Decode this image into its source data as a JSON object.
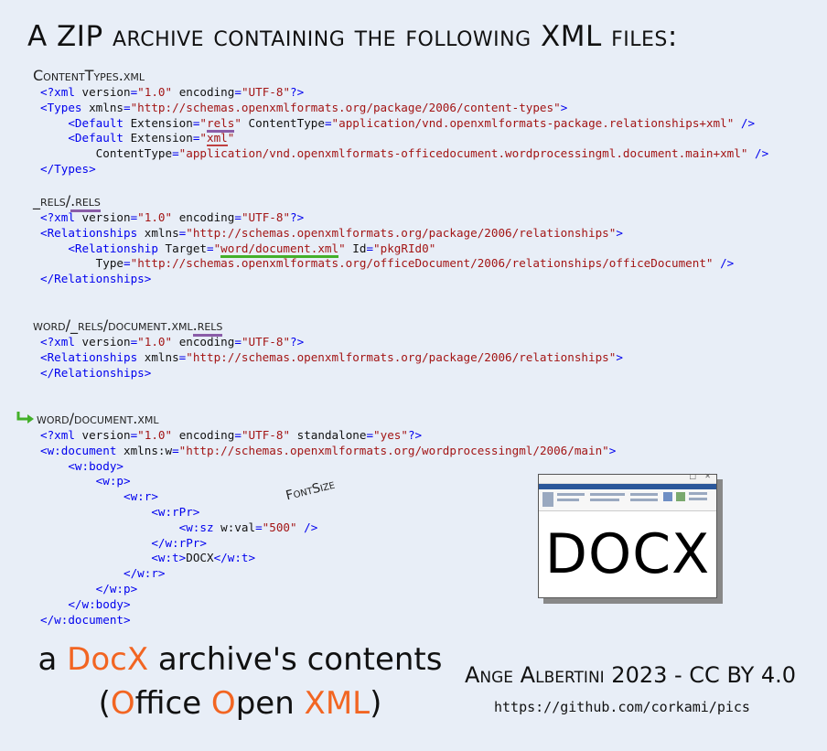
{
  "heading": "A ZIP archive containing the following XML files:",
  "files": [
    {
      "title": "ContentTypes.xml",
      "lines": [
        [
          [
            "t",
            "<?xml "
          ],
          [
            "a",
            "version"
          ],
          [
            "t",
            "="
          ],
          [
            "s",
            "\"1.0\""
          ],
          [
            "t",
            " "
          ],
          [
            "a",
            "encoding"
          ],
          [
            "t",
            "="
          ],
          [
            "s",
            "\"UTF-8\""
          ],
          [
            "t",
            "?>"
          ]
        ],
        [
          [
            "t",
            "<Types "
          ],
          [
            "a",
            "xmlns"
          ],
          [
            "t",
            "="
          ],
          [
            "s",
            "\"http://schemas.openxmlformats.org/package/2006/content-types\""
          ],
          [
            "t",
            ">"
          ]
        ],
        [
          [
            "t",
            "    <Default "
          ],
          [
            "a",
            "Extension"
          ],
          [
            "t",
            "="
          ],
          [
            "s",
            "\""
          ],
          [
            "s_u_purple",
            "rels"
          ],
          [
            "s",
            "\""
          ],
          [
            "t",
            " "
          ],
          [
            "a",
            "ContentType"
          ],
          [
            "t",
            "="
          ],
          [
            "s",
            "\"application/vnd.openxmlformats-package.relationships+xml\""
          ],
          [
            "t",
            " />"
          ]
        ],
        [
          [
            "t",
            "    <Default "
          ],
          [
            "a",
            "Extension"
          ],
          [
            "t",
            "="
          ],
          [
            "s",
            "\""
          ],
          [
            "s_u_red",
            "xml"
          ],
          [
            "s",
            "\""
          ]
        ],
        [
          [
            "t",
            "        "
          ],
          [
            "a",
            "ContentType"
          ],
          [
            "t",
            "="
          ],
          [
            "s",
            "\"application/vnd.openxmlformats-officedocument.wordprocessingml.document.main+xml\""
          ],
          [
            "t",
            " />"
          ]
        ],
        [
          [
            "t",
            "</Types>"
          ]
        ]
      ]
    },
    {
      "title_prefix": "_rels/",
      "title_underlined": ".rels",
      "lines": [
        [
          [
            "t",
            "<?xml "
          ],
          [
            "a",
            "version"
          ],
          [
            "t",
            "="
          ],
          [
            "s",
            "\"1.0\""
          ],
          [
            "t",
            " "
          ],
          [
            "a",
            "encoding"
          ],
          [
            "t",
            "="
          ],
          [
            "s",
            "\"UTF-8\""
          ],
          [
            "t",
            "?>"
          ]
        ],
        [
          [
            "t",
            "<Relationships "
          ],
          [
            "a",
            "xmlns"
          ],
          [
            "t",
            "="
          ],
          [
            "s",
            "\"http://schemas.openxmlformats.org/package/2006/relationships\""
          ],
          [
            "t",
            ">"
          ]
        ],
        [
          [
            "t",
            "    <Relationship "
          ],
          [
            "a",
            "Target"
          ],
          [
            "t",
            "="
          ],
          [
            "s",
            "\""
          ],
          [
            "s_u_green",
            "word/document.xml"
          ],
          [
            "s",
            "\""
          ],
          [
            "t",
            " "
          ],
          [
            "a",
            "Id"
          ],
          [
            "t",
            "="
          ],
          [
            "s",
            "\"pkgRId0\""
          ]
        ],
        [
          [
            "t",
            "        "
          ],
          [
            "a",
            "Type"
          ],
          [
            "t",
            "="
          ],
          [
            "s",
            "\"http://schemas.openxmlformats.org/officeDocument/2006/relationships/officeDocument\""
          ],
          [
            "t",
            " />"
          ]
        ],
        [
          [
            "t",
            "</Relationships>"
          ]
        ]
      ]
    },
    {
      "title_prefix": "word/_rels/document.xml",
      "title_underlined": ".rels",
      "lines": [
        [
          [
            "t",
            "<?xml "
          ],
          [
            "a",
            "version"
          ],
          [
            "t",
            "="
          ],
          [
            "s",
            "\"1.0\""
          ],
          [
            "t",
            " "
          ],
          [
            "a",
            "encoding"
          ],
          [
            "t",
            "="
          ],
          [
            "s",
            "\"UTF-8\""
          ],
          [
            "t",
            "?>"
          ]
        ],
        [
          [
            "t",
            "<Relationships "
          ],
          [
            "a",
            "xmlns"
          ],
          [
            "t",
            "="
          ],
          [
            "s",
            "\"http://schemas.openxmlformats.org/package/2006/relationships\""
          ],
          [
            "t",
            ">"
          ]
        ],
        [
          [
            "t",
            "</Relationships>"
          ]
        ]
      ]
    },
    {
      "title": "word/document.xml",
      "lines": [
        [
          [
            "t",
            "<?xml "
          ],
          [
            "a",
            "version"
          ],
          [
            "t",
            "="
          ],
          [
            "s",
            "\"1.0\""
          ],
          [
            "t",
            " "
          ],
          [
            "a",
            "encoding"
          ],
          [
            "t",
            "="
          ],
          [
            "s",
            "\"UTF-8\""
          ],
          [
            "t",
            " "
          ],
          [
            "a",
            "standalone"
          ],
          [
            "t",
            "="
          ],
          [
            "s",
            "\"yes\""
          ],
          [
            "t",
            "?>"
          ]
        ],
        [
          [
            "t",
            "<w:document "
          ],
          [
            "a",
            "xmlns:w"
          ],
          [
            "t",
            "="
          ],
          [
            "s",
            "\"http://schemas.openxmlformats.org/wordprocessingml/2006/main\""
          ],
          [
            "t",
            ">"
          ]
        ],
        [
          [
            "t",
            "    <w:body>"
          ]
        ],
        [
          [
            "t",
            "        <w:p>"
          ]
        ],
        [
          [
            "t",
            "            <w:r>"
          ]
        ],
        [
          [
            "t",
            "                <w:rPr>"
          ]
        ],
        [
          [
            "t",
            "                    <w:sz "
          ],
          [
            "a",
            "w:val"
          ],
          [
            "t",
            "="
          ],
          [
            "s",
            "\"500\""
          ],
          [
            "t",
            " />"
          ]
        ],
        [
          [
            "t",
            "                </w:rPr>"
          ]
        ],
        [
          [
            "t",
            "                <w:t>"
          ],
          [
            "a",
            "DOCX"
          ],
          [
            "t",
            "</w:t>"
          ]
        ],
        [
          [
            "t",
            "            </w:r>"
          ]
        ],
        [
          [
            "t",
            "        </w:p>"
          ]
        ],
        [
          [
            "t",
            "    </w:body>"
          ]
        ],
        [
          [
            "t",
            "</w:document>"
          ]
        ]
      ]
    }
  ],
  "annotation_fontsize": "FontSize",
  "preview_text": "DOCX",
  "title_line1": [
    "a ",
    "DocX",
    " archive's contents"
  ],
  "title_line2": [
    "(",
    "O",
    "ffice ",
    "O",
    "pen ",
    "XML",
    ")"
  ],
  "credit": "Ange Albertini 2023 - CC BY 4.0",
  "url": "https://github.com/corkami/pics",
  "colors": {
    "tag": "#0000ee",
    "string": "#a31515",
    "attr": "#111111",
    "accent": "#f26522",
    "background": "#e8eef7"
  }
}
